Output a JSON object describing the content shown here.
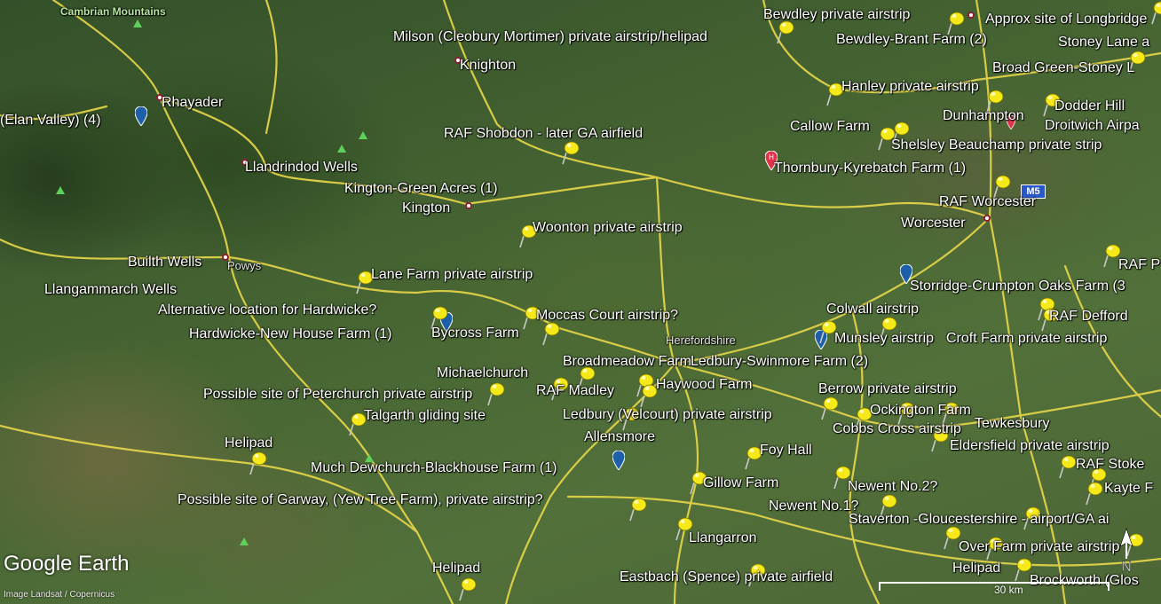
{
  "app": {
    "logo": "Google Earth",
    "attribution": "Image Landsat / Copernicus",
    "scale_label": "30 km",
    "compass_label": "N"
  },
  "colors": {
    "road": "#e8d84a",
    "pin": "#f6e91a",
    "town_ring": "#8a2232",
    "marker_blue": "#1d5fa8",
    "marker_red": "#e0344c"
  },
  "regions": [
    {
      "text": "Cambrian Mountains",
      "cls": "region-green"
    },
    {
      "text": "Powys",
      "cls": "region"
    },
    {
      "text": "Herefordshire",
      "cls": "region"
    }
  ],
  "places": [
    "Bewdley private airstrip",
    "Approx site of Longbridge",
    "Milson (Cleobury Mortimer) private airstrip/helipad",
    "Bewdley-Brant Farm (2)",
    "Stoney Lane a",
    "Knighton",
    "Broad Green-Stoney L",
    "Rhayader",
    "(Elan Valley) (4)",
    "Hanley private airstrip",
    "Dodder Hill",
    "Dunhampton",
    "Droitwich Airpa",
    "Callow Farm",
    "RAF Shobdon - later GA airfield",
    "Shelsley Beauchamp private strip",
    "Llandrindod Wells",
    "Thornbury-Kyrebatch Farm (1)",
    "Kington-Green Acres (1)",
    "RAF Worcester",
    "Kington",
    "Worcester",
    "Woonton private airstrip",
    "Builth Wells",
    "RAF P",
    "Lane Farm private airstrip",
    "Llangammarch Wells",
    "Storridge-Crumpton Oaks Farm (3",
    "Alternative location for Hardwicke?",
    "Colwall airstrip",
    "Moccas Court airstrip?",
    "RAF Defford",
    "Hardwicke-New House Farm (1)",
    "Bycross Farm",
    "Munsley airstrip",
    "Croft Farm private airstrip",
    "Broadmeadow Farm",
    "Ledbury-Swinmore Farm (2)",
    "Michaelchurch",
    "Haywood Farm",
    "RAF Madley",
    "Possible site of Peterchurch private airstrip",
    "Berrow private airstrip",
    "Ockington Farm",
    "Ledbury (Velcourt) private airstrip",
    "Talgarth gliding site",
    "Tewkesbury",
    "Cobbs Cross airstrip",
    "Allensmore",
    "Eldersfield private airstrip",
    "Helipad",
    "Foy Hall",
    "RAF Stoke",
    "Much Dewchurch-Blackhouse Farm (1)",
    "Gillow Farm",
    "Newent No.2?",
    "Kayte F",
    "Possible site of Garway, (Yew Tree Farm), private airstrip?",
    "Newent No.1?",
    "Staverton -Gloucestershire - airport/GA ai",
    "Llangarron",
    "Over Farm private airstrip",
    "Helipad",
    "Helipad",
    "Eastbach (Spence) private airfield",
    "Brockworth (Glos"
  ]
}
